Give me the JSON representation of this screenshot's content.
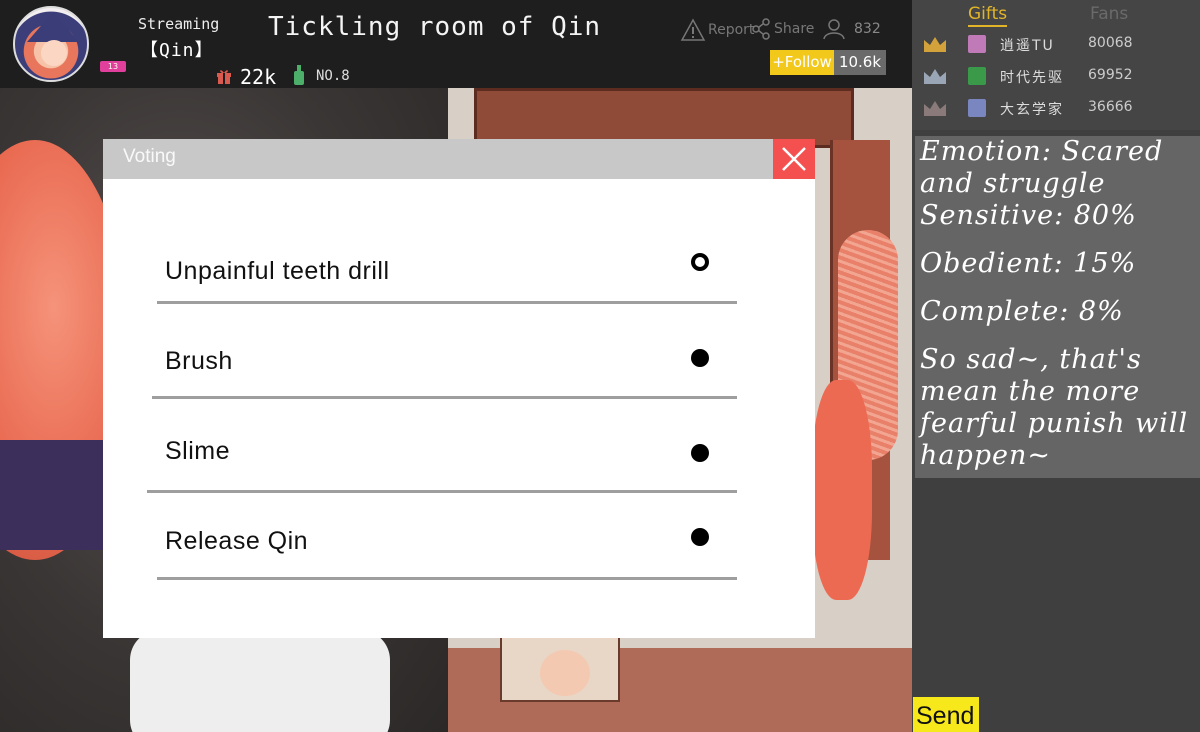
{
  "header": {
    "streaming_label": "Streaming",
    "host_name": "【Qin】",
    "level_badge": "13",
    "gift_count": "22k",
    "rank": "NO.8",
    "title": "Tickling room of Qin",
    "report_label": "Report",
    "share_label": "Share",
    "viewer_count": "832",
    "follow_label": "+Follow",
    "follower_count": "10.6k"
  },
  "voting": {
    "title": "Voting",
    "options": [
      {
        "label": "Unpainful teeth drill",
        "selected": true
      },
      {
        "label": "Brush",
        "selected": false
      },
      {
        "label": "Slime",
        "selected": false
      },
      {
        "label": "Release Qin",
        "selected": false
      }
    ]
  },
  "leaderboard": {
    "tabs": [
      "Gifts",
      "Fans"
    ],
    "active_tab": "Gifts",
    "entries": [
      {
        "name": "逍遥TU",
        "score": "80068",
        "crown_color": "#d4a23a"
      },
      {
        "name": "时代先驱",
        "score": "69952",
        "crown_color": "#9aa6b5"
      },
      {
        "name": "大玄学家",
        "score": "36666",
        "crown_color": "#8a7a7a"
      }
    ]
  },
  "chat": {
    "lines": [
      "Emotion: Scared and struggle",
      "Sensitive: 80%",
      "Obedient: 15%",
      "Complete: 8%",
      "So sad~, that's mean the more fearful punish will happen~"
    ],
    "send_label": "Send"
  },
  "colors": {
    "accent_follow": "#f2c81a",
    "close_button": "#f55050",
    "send_button": "#f6e81a",
    "gifts_tab": "#e2b528"
  }
}
